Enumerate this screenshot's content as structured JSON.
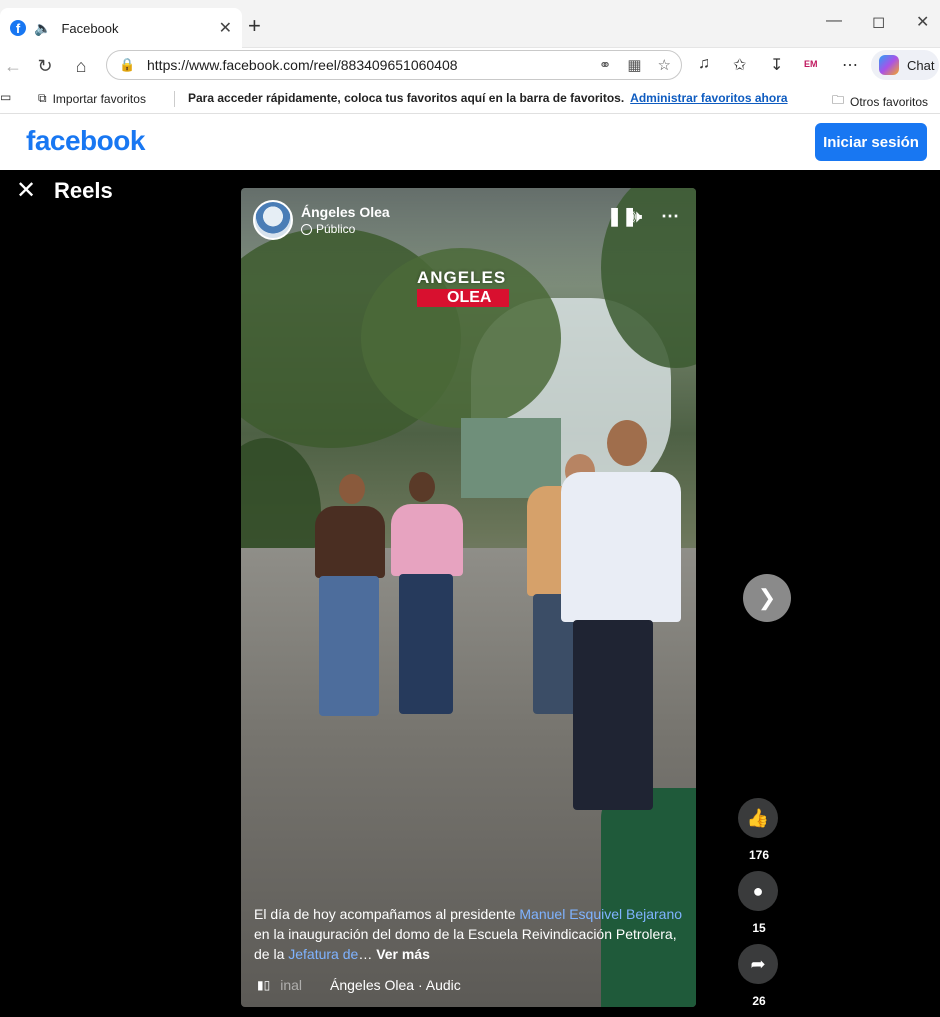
{
  "browser": {
    "tab_title": "Facebook",
    "new_tab": "+",
    "url": "https://www.facebook.com/reel/883409651060408",
    "chat_label": "Chat",
    "favorites_bar": {
      "import_label": "Importar favoritos",
      "hint": "Para acceder rápidamente, coloca tus favoritos aquí en la barra de favoritos.",
      "manage_link": "Administrar favoritos ahora",
      "other_label": "Otros favoritos"
    }
  },
  "facebook": {
    "logo": "facebook",
    "login_button": "Iniciar sesión"
  },
  "reels": {
    "title": "Reels",
    "video": {
      "author": "Ángeles Olea",
      "privacy": "Público",
      "watermark_top": "ANGELES",
      "watermark_bottom": "OLEA",
      "caption_1": "El día de hoy acompañamos al presidente ",
      "caption_mention_1": "Manuel Esquivel Bejarano",
      "caption_2": " en la inauguración del domo de la Escuela Reivindicación Petrolera, de la ",
      "caption_mention_2": "Jefatura de",
      "caption_ellipsis": "… ",
      "see_more": "Ver más",
      "audio_fade": "inal",
      "audio_label": "Ángeles Olea · Audic"
    },
    "actions": {
      "likes": "176",
      "comments": "15",
      "shares": "26"
    }
  },
  "icons": [
    "facebook-favicon-icon",
    "speaker-icon",
    "close-icon",
    "plus-icon",
    "minimize-icon",
    "maximize-icon",
    "back-icon",
    "refresh-icon",
    "home-icon",
    "lock-icon",
    "key-icon",
    "app-icon",
    "star-icon",
    "read-aloud-icon",
    "favorites-icon",
    "download-icon",
    "more-icon",
    "copilot-icon",
    "pause-icon",
    "volume-icon",
    "chevron-right-icon",
    "like-icon",
    "comment-icon",
    "share-icon"
  ],
  "colors": {
    "facebook_blue": "#1877f2",
    "mention_blue": "#7fb3ff",
    "watermark_red": "#d8102f"
  }
}
